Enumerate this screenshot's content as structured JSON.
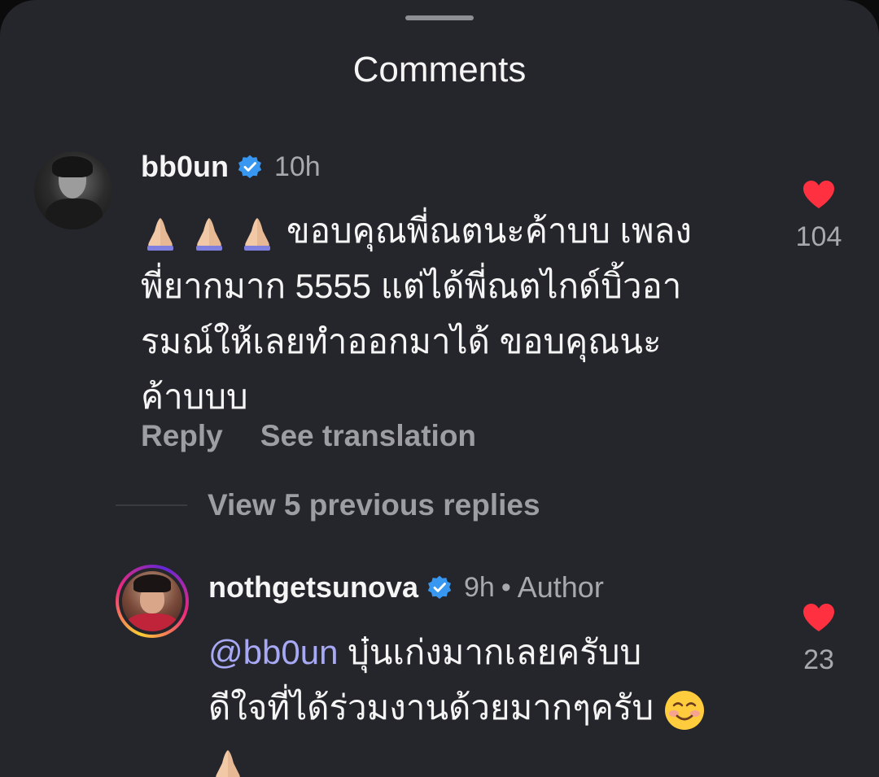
{
  "sheet": {
    "title": "Comments"
  },
  "comment": {
    "username": "bb0un",
    "time": "10h",
    "text_line_1": "ขอบคุณพี่ณตนะค้าบบ เพลง",
    "text_line_2": "พี่ยากมาก 5555 แต่ได้พี่ณตไกด์บิ้วอา",
    "text_line_3": "รมณ์ให้เลยทำออกมาได้ ขอบคุณนะ",
    "text_line_4": "ค้าบบบ",
    "emoji": "pray-icon x3",
    "likes": "104",
    "reply_label": "Reply",
    "translate_label": "See translation"
  },
  "view_replies": "View 5 previous replies",
  "reply": {
    "username": "nothgetsunova",
    "time": "9h",
    "separator": "•",
    "author_label": "Author",
    "mention": "@bb0un",
    "text_line_1": " บุ๋นเก่งมากเลยครับบ",
    "text_line_2": "ดีใจที่ได้ร่วมงานด้วยมากๆครับ ",
    "likes": "23"
  },
  "colors": {
    "background": "#25262b",
    "like_red": "#ff3040",
    "verified_blue": "#3897f0",
    "mention": "#a7a9f5",
    "muted": "#a8a9ae"
  }
}
